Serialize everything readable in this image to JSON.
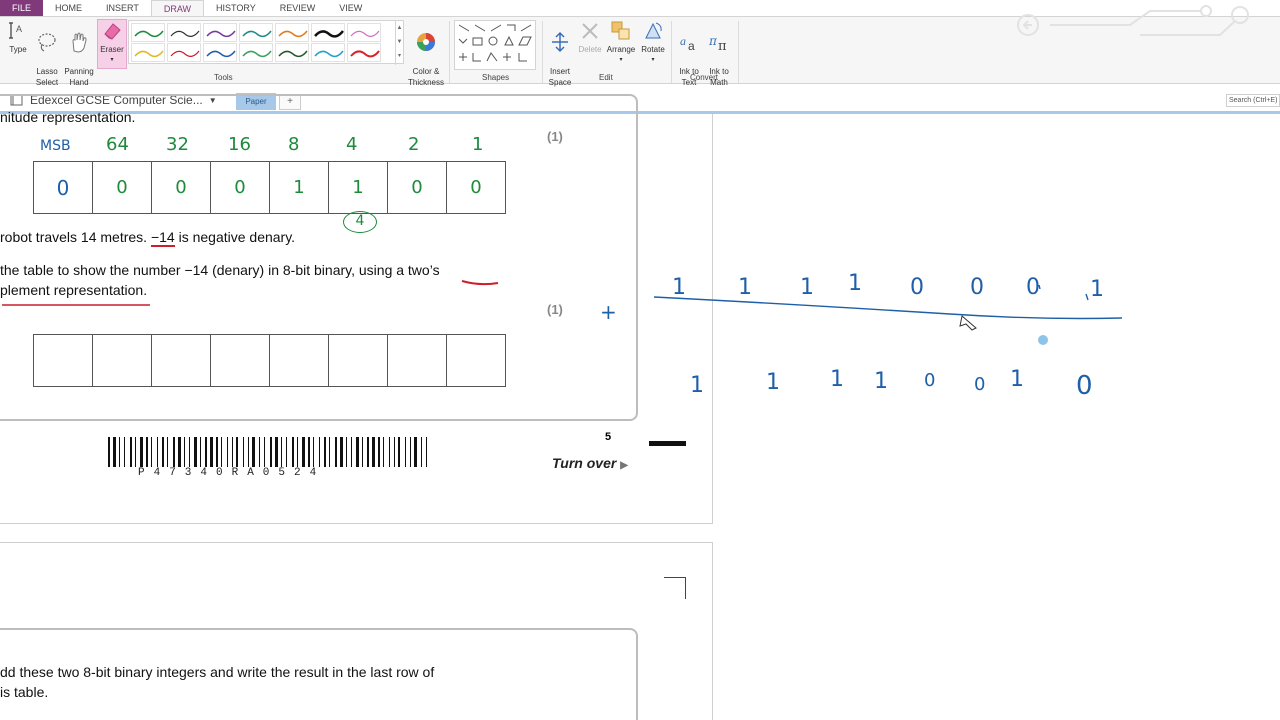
{
  "ribbon_tabs": [
    "FILE",
    "HOME",
    "INSERT",
    "DRAW",
    "HISTORY",
    "REVIEW",
    "VIEW"
  ],
  "active_tab": "DRAW",
  "tools": {
    "type_label": "Type",
    "lasso_label": "Lasso\nSelect",
    "panning_label": "Panning\nHand",
    "eraser_label": "Eraser",
    "color_label": "Color &\nThickness",
    "group_label": "Tools"
  },
  "shapes_group_label": "Shapes",
  "edit": {
    "insert_space_label": "Insert\nSpace",
    "delete_label": "Delete",
    "arrange_label": "Arrange",
    "rotate_label": "Rotate",
    "group_label": "Edit"
  },
  "convert": {
    "ink_to_text_label": "Ink to\nText",
    "ink_to_math_label": "Ink to\nMath",
    "group_label": "Convert"
  },
  "notebook": {
    "name": "Edexcel GCSE Computer Scie...",
    "page_tab": "Paper",
    "add_tab": "+"
  },
  "search_placeholder": "Search (Ctrl+E)",
  "question": {
    "top_fragment": "nitude representation.",
    "mark1": "(1)",
    "line1_a": "robot travels 14 metres. ",
    "line1_b": "−14",
    "line1_c": " is negative denary.",
    "line2": "the table to show the number −14 (denary) in 8-bit binary, using a two’s",
    "line3": "plement representation.",
    "mark2": "(1)",
    "page_number": "5",
    "turn_over": "Turn over",
    "barcode_text": "P47340RA0524",
    "q2_line1": "dd these two 8-bit binary integers and write the result in the last row of",
    "q2_line2": "is table."
  },
  "handwriting": {
    "headers": [
      "MSB",
      "64",
      "32",
      "16",
      "8",
      "4",
      "2",
      "1"
    ],
    "table1": [
      "0",
      "0",
      "0",
      "0",
      "1",
      "1",
      "0",
      "0"
    ],
    "circled": "4",
    "row_top": [
      "1",
      "1",
      "1",
      "1",
      "0",
      "0",
      "0",
      "1"
    ],
    "row_bottom": [
      "1",
      "1",
      "1",
      "1",
      "0",
      "0",
      "1",
      "0"
    ],
    "plus": "+"
  },
  "colors": {
    "accent_purple": "#80397b",
    "ink_green": "#1e8a3c",
    "ink_blue": "#1f5fa8",
    "ink_red": "#cc1f2c"
  }
}
